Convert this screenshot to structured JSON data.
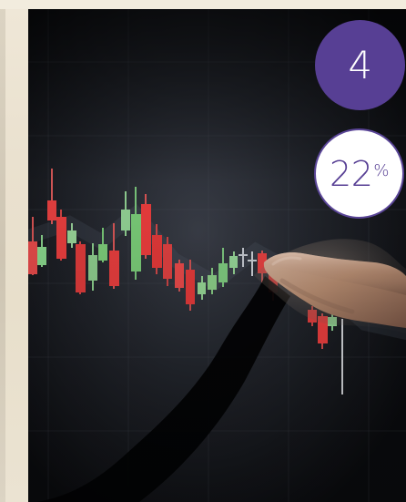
{
  "badges": {
    "primary_value": "4",
    "secondary_value": "22",
    "secondary_unit": "%"
  },
  "colors": {
    "badge_primary_bg": "#573f94",
    "badge_primary_text": "#ffffff",
    "badge_secondary_bg": "#ffffff",
    "badge_secondary_text": "#573f94",
    "candle_up": "#7ac66f",
    "candle_down": "#e63b3b",
    "background": "#f2ecde"
  }
}
